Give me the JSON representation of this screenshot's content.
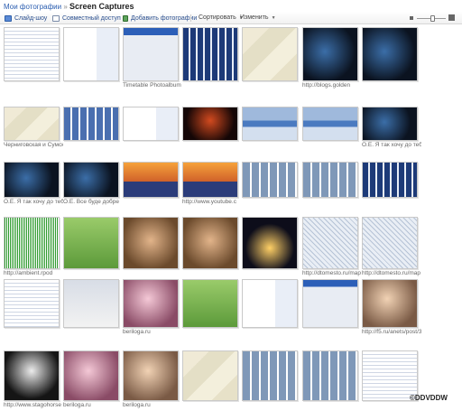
{
  "breadcrumb": {
    "parent": "Мои фотографии",
    "separator": "»",
    "current": "Screen Captures"
  },
  "toolbar": {
    "slideshow": "Слайд-шоу",
    "share": "Совместный доступ",
    "add_photos": "Добавить фотографии",
    "sort": "Сортировать",
    "edit": "Изменить"
  },
  "watermark": "©DDVDDW",
  "rows": [
    {
      "items": [
        {
          "texture": "t-doc",
          "caption": ""
        },
        {
          "texture": "t-page",
          "caption": ""
        },
        {
          "texture": "t-win",
          "caption": "Timetable Photoalbum »"
        },
        {
          "texture": "t-tiles",
          "caption": ""
        },
        {
          "texture": "t-map",
          "caption": ""
        },
        {
          "texture": "t-dark",
          "caption": "http://blogs.golden"
        },
        {
          "texture": "t-dark",
          "caption": ""
        }
      ]
    },
    {
      "items": [
        {
          "texture": "t-map",
          "caption": "Черниговская и Сумская"
        },
        {
          "texture": "t-mosaic",
          "caption": ""
        },
        {
          "texture": "t-page",
          "caption": ""
        },
        {
          "texture": "t-darkred",
          "caption": ""
        },
        {
          "texture": "t-bar",
          "caption": ""
        },
        {
          "texture": "t-bar",
          "caption": ""
        },
        {
          "texture": "t-dark",
          "caption": "О.Е. Я так хочу до тебе"
        }
      ]
    },
    {
      "items": [
        {
          "texture": "t-dark",
          "caption": "О.Е. Я так хочу до тебе"
        },
        {
          "texture": "t-dark",
          "caption": "О.Е. Все буде добре"
        },
        {
          "texture": "t-stage",
          "caption": ""
        },
        {
          "texture": "t-stage",
          "caption": "http://www.youtube.c"
        },
        {
          "texture": "t-strip",
          "caption": ""
        },
        {
          "texture": "t-strip",
          "caption": ""
        },
        {
          "texture": "t-tiles",
          "caption": ""
        }
      ]
    },
    {
      "items": [
        {
          "texture": "t-wave",
          "caption": "http://ambient.rpod"
        },
        {
          "texture": "t-green",
          "caption": ""
        },
        {
          "texture": "t-photo",
          "caption": ""
        },
        {
          "texture": "t-photo",
          "caption": ""
        },
        {
          "texture": "t-night",
          "caption": ""
        },
        {
          "texture": "t-street",
          "caption": "http://dtomesto.ru/map"
        },
        {
          "texture": "t-street",
          "caption": "http://dtomesto.ru/map"
        }
      ]
    },
    {
      "items": [
        {
          "texture": "t-doc",
          "caption": ""
        },
        {
          "texture": "t-err",
          "caption": ""
        },
        {
          "texture": "t-pink",
          "caption": "beriloga.ru"
        },
        {
          "texture": "t-green",
          "caption": ""
        },
        {
          "texture": "t-page",
          "caption": ""
        },
        {
          "texture": "t-win",
          "caption": ""
        },
        {
          "texture": "t-photo2",
          "caption": "http://f5.ru/anets/post/34"
        }
      ]
    },
    {
      "items": [
        {
          "texture": "t-bw",
          "caption": "http://www.stagohorse"
        },
        {
          "texture": "t-pink",
          "caption": "beriloga.ru"
        },
        {
          "texture": "t-photo2",
          "caption": "beriloga.ru"
        },
        {
          "texture": "t-map",
          "caption": ""
        },
        {
          "texture": "t-strip",
          "caption": ""
        },
        {
          "texture": "t-strip",
          "caption": ""
        },
        {
          "texture": "t-doc",
          "caption": ""
        }
      ]
    }
  ]
}
